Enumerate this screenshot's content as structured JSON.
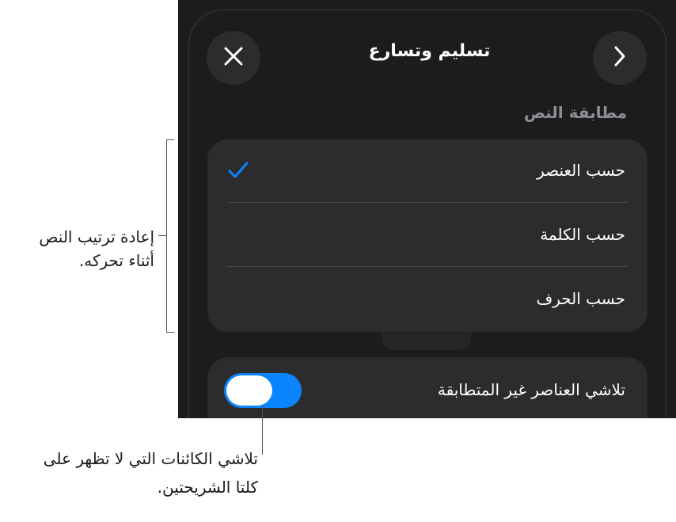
{
  "header": {
    "title": "تسليم وتسارع",
    "close_icon": "close-icon",
    "back_icon": "chevron-right-icon"
  },
  "text_matching": {
    "section_label": "مطابقة النص",
    "options": [
      {
        "label": "حسب العنصر",
        "selected": true
      },
      {
        "label": "حسب الكلمة",
        "selected": false
      },
      {
        "label": "حسب الحرف",
        "selected": false
      }
    ]
  },
  "fade_toggle": {
    "label": "تلاشي العناصر غير المتطابقة",
    "on": true
  },
  "callouts": {
    "rearrange_line1": "إعادة ترتيب النص",
    "rearrange_line2": "أثناء تحركه.",
    "fade_line1": "تلاشي الكائنات التي لا تظهر على",
    "fade_line2": "كلتا الشريحتين."
  },
  "colors": {
    "panel_bg": "#1c1c1e",
    "group_bg": "#2c2c2e",
    "accent": "#0a84ff",
    "secondary_text": "#8e8e93"
  }
}
